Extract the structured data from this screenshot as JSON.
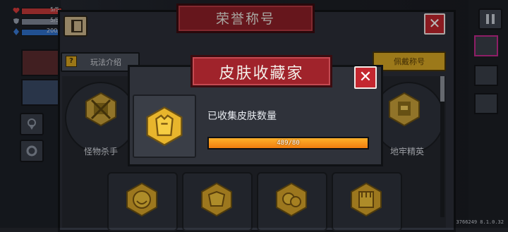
{
  "hud": {
    "stats": [
      {
        "icon": "heart-icon",
        "value": "5/5",
        "color": "#d63b3b",
        "fill": 1.0
      },
      {
        "icon": "shield-icon",
        "value": "5/5",
        "color": "#8a93a3",
        "fill": 1.0
      },
      {
        "icon": "energy-icon",
        "value": "200/",
        "color": "#3a7bd6",
        "fill": 1.0
      }
    ],
    "uid": "UID:3766249 8.1.0.32"
  },
  "main_panel": {
    "title": "荣誉称号",
    "help_label": "玩法介绍",
    "collect_label": "佩戴称号",
    "badges": [
      {
        "label": "怪物杀手",
        "icon": "monster-skull-badge-icon"
      },
      {
        "label": "地牢精英",
        "icon": "dungeon-elite-badge-icon"
      },
      {
        "label": "",
        "icon": "smiley-badge-icon"
      },
      {
        "label": "",
        "icon": "armor-badge-icon"
      },
      {
        "label": "",
        "icon": "creature-badge-icon"
      },
      {
        "label": "",
        "icon": "fist-badge-icon"
      }
    ]
  },
  "popup": {
    "title": "皮肤收藏家",
    "label": "已收集皮肤数量",
    "progress_text": "489/80",
    "progress_fraction": 1.0,
    "accent": "#f39a1a"
  }
}
